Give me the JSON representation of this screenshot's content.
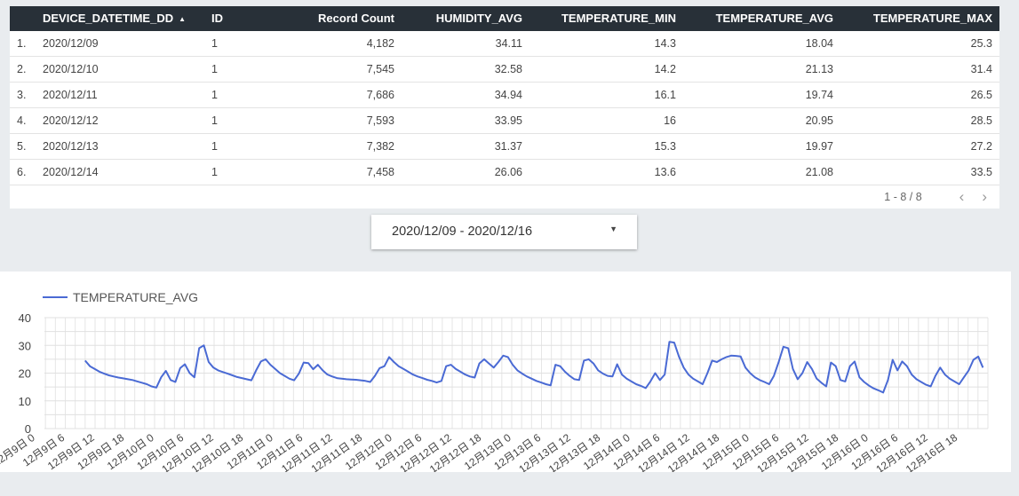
{
  "table": {
    "columns": [
      {
        "label": "DEVICE_DATETIME_DD",
        "sorted": "▲"
      },
      {
        "label": "ID"
      },
      {
        "label": "Record Count"
      },
      {
        "label": "HUMIDITY_AVG"
      },
      {
        "label": "TEMPERATURE_MIN"
      },
      {
        "label": "TEMPERATURE_AVG"
      },
      {
        "label": "TEMPERATURE_MAX"
      }
    ],
    "rows": [
      {
        "index": "1.",
        "date": "2020/12/09",
        "id": "1",
        "count": "4,182",
        "humidity": "34.11",
        "tmin": "14.3",
        "tavg": "18.04",
        "tmax": "25.3"
      },
      {
        "index": "2.",
        "date": "2020/12/10",
        "id": "1",
        "count": "7,545",
        "humidity": "32.58",
        "tmin": "14.2",
        "tavg": "21.13",
        "tmax": "31.4"
      },
      {
        "index": "3.",
        "date": "2020/12/11",
        "id": "1",
        "count": "7,686",
        "humidity": "34.94",
        "tmin": "16.1",
        "tavg": "19.74",
        "tmax": "26.5"
      },
      {
        "index": "4.",
        "date": "2020/12/12",
        "id": "1",
        "count": "7,593",
        "humidity": "33.95",
        "tmin": "16",
        "tavg": "20.95",
        "tmax": "28.5"
      },
      {
        "index": "5.",
        "date": "2020/12/13",
        "id": "1",
        "count": "7,382",
        "humidity": "31.37",
        "tmin": "15.3",
        "tavg": "19.97",
        "tmax": "27.2"
      },
      {
        "index": "6.",
        "date": "2020/12/14",
        "id": "1",
        "count": "7,458",
        "humidity": "26.06",
        "tmin": "13.6",
        "tavg": "21.08",
        "tmax": "33.5"
      }
    ],
    "pagination": {
      "text": "1 - 8 / 8",
      "prev_icon": "chevron-left-icon",
      "next_icon": "chevron-right-icon"
    }
  },
  "date_range": {
    "value": "2020/12/09 - 2020/12/16",
    "icon": "caret-down-icon"
  },
  "chart_data": {
    "type": "line",
    "series": [
      {
        "name": "TEMPERATURE_AVG",
        "color": "#4a6ad4",
        "x_hours": [
          0,
          1,
          2,
          3,
          4,
          5,
          6,
          7,
          8,
          9,
          10,
          11,
          12,
          13,
          14,
          15,
          16,
          17,
          18,
          19,
          20,
          21,
          22,
          23,
          24,
          25,
          26,
          27,
          28,
          29,
          30,
          31,
          32,
          33,
          34,
          35,
          36,
          37,
          38,
          39,
          40,
          41,
          42,
          43,
          44,
          45,
          46,
          47,
          48,
          49,
          50,
          51,
          52,
          53,
          54,
          55,
          56,
          57,
          58,
          59,
          60,
          61,
          62,
          63,
          64,
          65,
          66,
          67,
          68,
          69,
          70,
          71,
          72,
          73,
          74,
          75,
          76,
          77,
          78,
          79,
          80,
          81,
          82,
          83,
          84,
          85,
          86,
          87,
          88,
          89,
          90,
          91,
          92,
          93,
          94,
          95,
          96,
          97,
          98,
          99,
          100,
          101,
          102,
          103,
          104,
          105,
          106,
          107,
          108,
          109,
          110,
          111,
          112,
          113,
          114,
          115,
          116,
          117,
          118,
          119,
          120,
          121,
          122,
          123,
          124,
          125,
          126,
          127,
          128,
          129,
          130,
          131,
          132,
          133,
          134,
          135,
          136,
          137,
          138,
          139,
          140,
          141,
          142,
          143,
          144,
          145,
          146,
          147,
          148,
          149,
          150,
          151,
          152,
          153,
          154,
          155,
          156,
          157,
          158,
          159,
          160,
          161,
          162,
          163,
          164,
          165,
          166,
          167,
          168,
          169,
          170,
          171,
          172,
          173,
          174,
          175,
          176,
          177,
          178,
          179,
          180,
          181,
          182,
          183,
          184,
          185,
          186,
          187,
          188,
          189,
          190,
          191
        ],
        "values": [
          24.5,
          22.5,
          21.5,
          20.5,
          19.8,
          19.2,
          18.8,
          18.4,
          18.1,
          17.8,
          17.5,
          17.0,
          16.5,
          16.0,
          15.2,
          14.8,
          18.5,
          20.8,
          17.5,
          16.8,
          21.8,
          23.2,
          20.0,
          18.5,
          29.0,
          30.0,
          24.0,
          22.0,
          21.0,
          20.4,
          19.8,
          19.2,
          18.6,
          18.2,
          17.8,
          17.4,
          21.0,
          24.2,
          25.0,
          23.0,
          21.5,
          20.0,
          19.0,
          18.0,
          17.4,
          19.8,
          23.8,
          23.6,
          21.4,
          23.0,
          21.0,
          19.5,
          18.8,
          18.2,
          18.0,
          17.8,
          17.7,
          17.6,
          17.4,
          17.2,
          16.8,
          19.0,
          21.8,
          22.5,
          25.8,
          24.0,
          22.5,
          21.5,
          20.5,
          19.5,
          18.8,
          18.2,
          17.6,
          17.2,
          16.6,
          17.2,
          22.5,
          23.0,
          21.5,
          20.5,
          19.5,
          18.8,
          18.4,
          23.5,
          25.0,
          23.5,
          22.0,
          24.0,
          26.3,
          25.8,
          23.0,
          21.0,
          19.8,
          18.8,
          18.0,
          17.2,
          16.6,
          16.0,
          15.6,
          23.0,
          22.5,
          20.5,
          19.0,
          17.8,
          17.5,
          24.5,
          25.0,
          23.5,
          21.0,
          19.8,
          19.0,
          18.8,
          23.2,
          19.5,
          18.0,
          17.0,
          16.0,
          15.4,
          14.6,
          17.0,
          20.0,
          17.5,
          19.5,
          31.3,
          31.0,
          26.0,
          22.0,
          19.5,
          18.0,
          17.0,
          16.0,
          20.0,
          24.5,
          24.0,
          25.0,
          25.8,
          26.3,
          26.2,
          26.0,
          22.0,
          20.0,
          18.5,
          17.5,
          16.8,
          16.0,
          19.0,
          24.0,
          29.5,
          29.0,
          21.5,
          17.8,
          20.0,
          24.0,
          21.5,
          18.0,
          16.5,
          15.2,
          23.8,
          22.5,
          17.5,
          17.0,
          22.5,
          24.2,
          18.5,
          16.8,
          15.5,
          14.5,
          13.8,
          13.0,
          17.5,
          24.8,
          21.0,
          24.2,
          22.5,
          19.5,
          17.8,
          16.8,
          15.8,
          15.2,
          19.0,
          22.0,
          19.5,
          18.0,
          17.0,
          16.0,
          18.5,
          21.0,
          24.8,
          26.0,
          22.0
        ]
      }
    ],
    "ylim": [
      0,
      40
    ],
    "y_ticks": [
      "0",
      "10",
      "20",
      "30",
      "40"
    ],
    "x_tick_labels": [
      "12月9日 0",
      "12月9日 6",
      "12月9日 12",
      "12月9日 18",
      "12月10日 0",
      "12月10日 6",
      "12月10日 12",
      "12月10日 18",
      "12月11日 0",
      "12月11日 6",
      "12月11日 12",
      "12月11日 18",
      "12月12日 0",
      "12月12日 6",
      "12月12日 12",
      "12月12日 18",
      "12月13日 0",
      "12月13日 6",
      "12月13日 12",
      "12月13日 18",
      "12月14日 0",
      "12月14日 6",
      "12月14日 12",
      "12月14日 18",
      "12月15日 0",
      "12月15日 6",
      "12月15日 12",
      "12月15日 18",
      "12月16日 0",
      "12月16日 6",
      "12月16日 12",
      "12月16日 18"
    ],
    "grid": true,
    "legend": "top-left"
  }
}
